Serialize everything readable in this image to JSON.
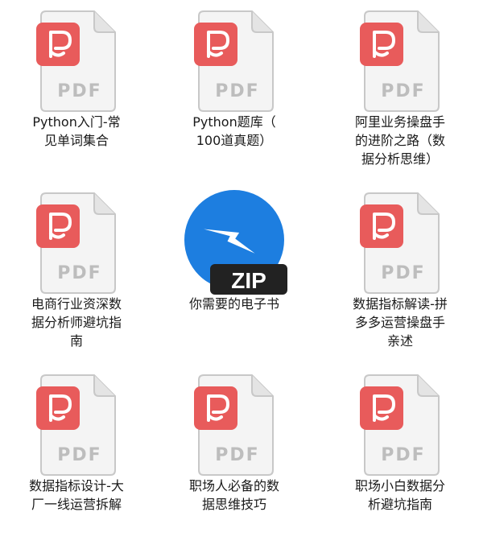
{
  "files": [
    {
      "name": "Python入门-常\n见单词集合",
      "type": "pdf",
      "badge": "PDF"
    },
    {
      "name": "Python题库（\n100道真题）",
      "type": "pdf",
      "badge": "PDF"
    },
    {
      "name": "阿里业务操盘手\n的进阶之路（数\n据分析思维）",
      "type": "pdf",
      "badge": "PDF"
    },
    {
      "name": "电商行业资深数\n据分析师避坑指\n南",
      "type": "pdf",
      "badge": "PDF"
    },
    {
      "name": "你需要的电子书",
      "type": "zip",
      "badge": "ZIP"
    },
    {
      "name": "数据指标解读-拼\n多多运营操盘手\n亲述",
      "type": "pdf",
      "badge": "PDF"
    },
    {
      "name": "数据指标设计-大\n厂一线运营拆解",
      "type": "pdf",
      "badge": "PDF"
    },
    {
      "name": "职场人必备的数\n据思维技巧",
      "type": "pdf",
      "badge": "PDF"
    },
    {
      "name": "职场小白数据分\n析避坑指南",
      "type": "pdf",
      "badge": "PDF"
    }
  ],
  "colors": {
    "pdf_accent": "#e85b5b",
    "zip_accent": "#1d7ee0",
    "zip_badge": "#222222",
    "paper": "#f4f4f4",
    "paper_border": "#c8c8c8",
    "badge_text": "#bdbdbd"
  },
  "icons": {
    "pdf": "pdf-file-icon",
    "zip": "zip-archive-icon"
  }
}
